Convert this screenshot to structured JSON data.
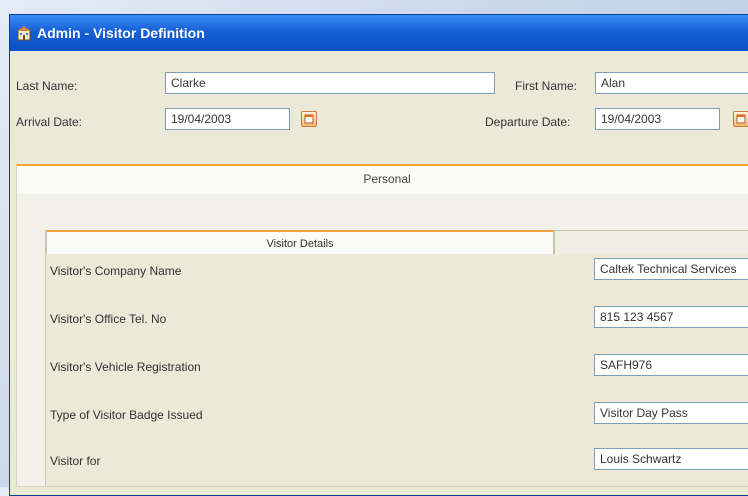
{
  "window": {
    "title": "Admin - Visitor Definition",
    "icon": "building-icon"
  },
  "form": {
    "last_name_label": "Last Name:",
    "last_name_value": "Clarke",
    "first_name_label": "First Name:",
    "first_name_value": "Alan",
    "arrival_date_label": "Arrival Date:",
    "arrival_date_value": "19/04/2003",
    "departure_date_label": "Departure Date:",
    "departure_date_value": "19/04/2003"
  },
  "panel": {
    "title": "Personal"
  },
  "tabs": [
    {
      "label": "Visitor Details",
      "active": true
    },
    {
      "label": "",
      "active": false
    }
  ],
  "details": [
    {
      "label": "Visitor's Company Name",
      "value": "Caltek Technical Services"
    },
    {
      "label": "Visitor's Office Tel. No",
      "value": "815 123 4567"
    },
    {
      "label": "Visitor's Vehicle Registration",
      "value": "SAFH976"
    },
    {
      "label": "Type of Visitor Badge Issued",
      "value": "Visitor Day Pass"
    },
    {
      "label": "Visitor for",
      "value": "Louis Schwartz"
    }
  ],
  "colors": {
    "titlebar": "#1560d6",
    "accent": "#f3a53c",
    "window_bg": "#ece9d8"
  }
}
